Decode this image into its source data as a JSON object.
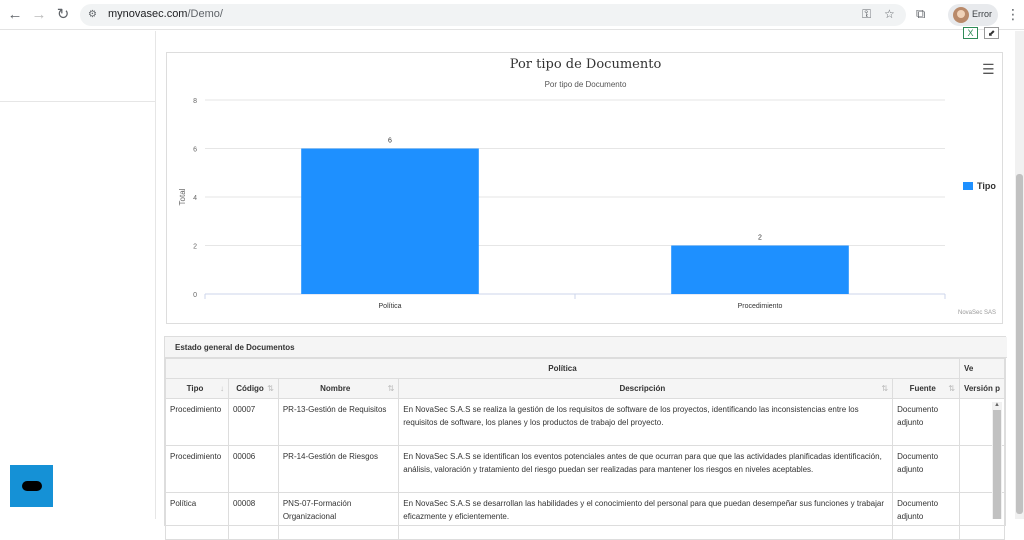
{
  "browser": {
    "url_domain": "mynovasec.com",
    "url_path": "/Demo/",
    "profile_label": "Error"
  },
  "chart_data": {
    "type": "bar",
    "title": "Por tipo de Documento",
    "subtitle": "Por tipo de Documento",
    "categories": [
      "Política",
      "Procedimiento"
    ],
    "series": [
      {
        "name": "Tipo",
        "values": [
          6,
          2
        ]
      }
    ],
    "ylabel": "Total",
    "xlabel": "",
    "ylim": [
      0,
      8
    ],
    "yticks": [
      0,
      2,
      4,
      6,
      8
    ],
    "color": "#1e90ff",
    "legend_position": "right",
    "grid": true,
    "credits": "NovaSec SAS"
  },
  "table": {
    "title": "Estado general de Documentos",
    "group_header": "Política",
    "group_header_right": "Ve",
    "columns": [
      "Tipo",
      "Código",
      "Nombre",
      "Descripción",
      "Fuente",
      "Versión p"
    ],
    "rows": [
      {
        "tipo": "Procedimiento",
        "codigo": "00007",
        "nombre": "PR-13-Gestión de Requisitos",
        "descripcion": "En NovaSec S.A.S se realiza la gestión de los requisitos de software de los proyectos, identificando las inconsistencias entre los requisitos de software, los planes y los productos de trabajo del proyecto.",
        "fuente": "Documento adjunto",
        "version": ""
      },
      {
        "tipo": "Procedimiento",
        "codigo": "00006",
        "nombre": "PR-14-Gestión de Riesgos",
        "descripcion": "En NovaSec S.A.S se identifican los eventos potenciales antes de que ocurran para que que las actividades planificadas identificación, análisis, valoración y tratamiento del riesgo puedan ser realizadas para mantener los riesgos en niveles aceptables.",
        "fuente": "Documento adjunto",
        "version": ""
      },
      {
        "tipo": "Política",
        "codigo": "00008",
        "nombre": "PNS-07-Formación Organizacional",
        "descripcion": "En NovaSec S.A.S se desarrollan las habilidades y el conocimiento del personal para que puedan desempeñar sus funciones y trabajar eficazmente y eficientemente.",
        "fuente": "Documento adjunto",
        "version": ""
      }
    ]
  },
  "icons": [
    "back-arrow-icon",
    "forward-arrow-icon",
    "reload-icon",
    "site-info-icon",
    "password-key-icon",
    "star-icon",
    "extensions-icon",
    "kebab-menu-icon",
    "excel-icon",
    "expand-icon",
    "hamburger-menu-icon",
    "chat-icon"
  ]
}
